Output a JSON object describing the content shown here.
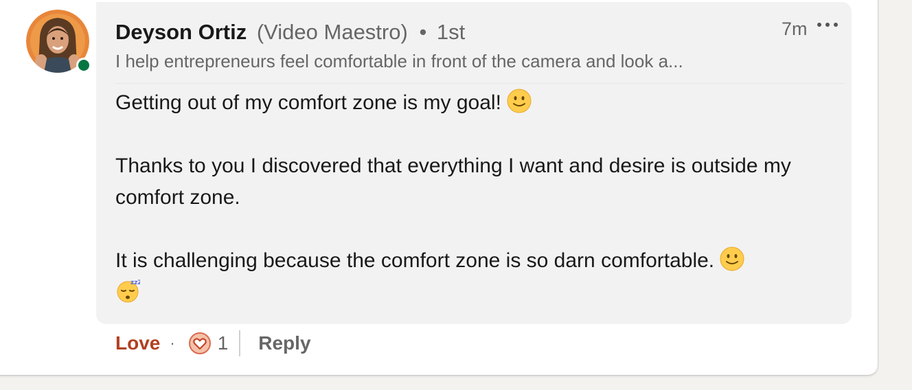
{
  "comment": {
    "author_name": "Deyson Ortiz",
    "author_designation": "(Video Maestro)",
    "separator": "•",
    "connection_degree": "1st",
    "headline": "I help entrepreneurs feel comfortable in front of the camera and look a...",
    "timestamp": "7m",
    "online_status_color": "#057642",
    "paragraphs": [
      {
        "text": "Getting out of my comfort zone is my goal! ",
        "emojis": [
          "slightly-smiling-face-icon"
        ]
      },
      {
        "text": "Thanks to you I discovered that everything I want and desire is outside my comfort zone.",
        "emojis": []
      },
      {
        "text": "It is challenging because the comfort zone is so darn comfortable. ",
        "emojis": [
          "slightly-smiling-face-icon",
          "sleeping-face-icon"
        ]
      }
    ]
  },
  "actions": {
    "love_label": "Love",
    "dot": "·",
    "reaction_icon": "love-heart-icon",
    "reaction_count": "1",
    "reply_label": "Reply"
  },
  "colors": {
    "love_accent": "#b24020",
    "bubble_bg": "#f2f2f2",
    "secondary_text": "#666666"
  }
}
